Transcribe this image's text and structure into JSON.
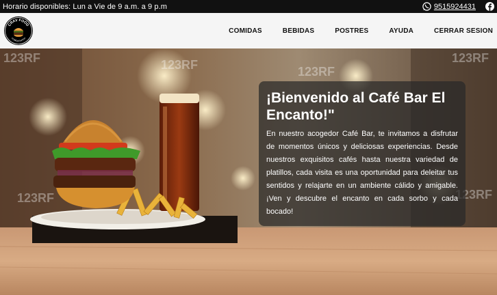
{
  "topbar": {
    "hours": "Horario disponibles: Lun a Vie de 9 a.m. a 9 p.m",
    "phone": "9515924431",
    "whatsapp_icon": "whatsapp-icon",
    "facebook_icon": "facebook-icon"
  },
  "logo": {
    "name": "logo",
    "top_text": "CRAV FOOD",
    "bottom_text": "COMIDA RAPIDA"
  },
  "nav": {
    "items": [
      {
        "label": "COMIDAS"
      },
      {
        "label": "BEBIDAS"
      },
      {
        "label": "POSTRES"
      },
      {
        "label": "AYUDA"
      },
      {
        "label": "CERRAR SESION"
      }
    ]
  },
  "hero": {
    "title": "¡Bienvenido al Café Bar El Encanto!\"",
    "body": "En nuestro acogedor Café Bar, te invitamos a disfrutar de momentos únicos y deliciosas experiencias. Desde nuestros exquisitos cafés hasta nuestra variedad de platillos, cada visita es una oportunidad para deleitar tus sentidos y relajarte en un ambiente cálido y amigable. ¡Ven y descubre el encanto en cada sorbo y cada bocado!",
    "watermark": "123RF"
  },
  "colors": {
    "topbar_bg": "#111111",
    "navbar_bg": "#f5f5f5",
    "panel_bg": "rgba(40,40,40,0.72)"
  }
}
